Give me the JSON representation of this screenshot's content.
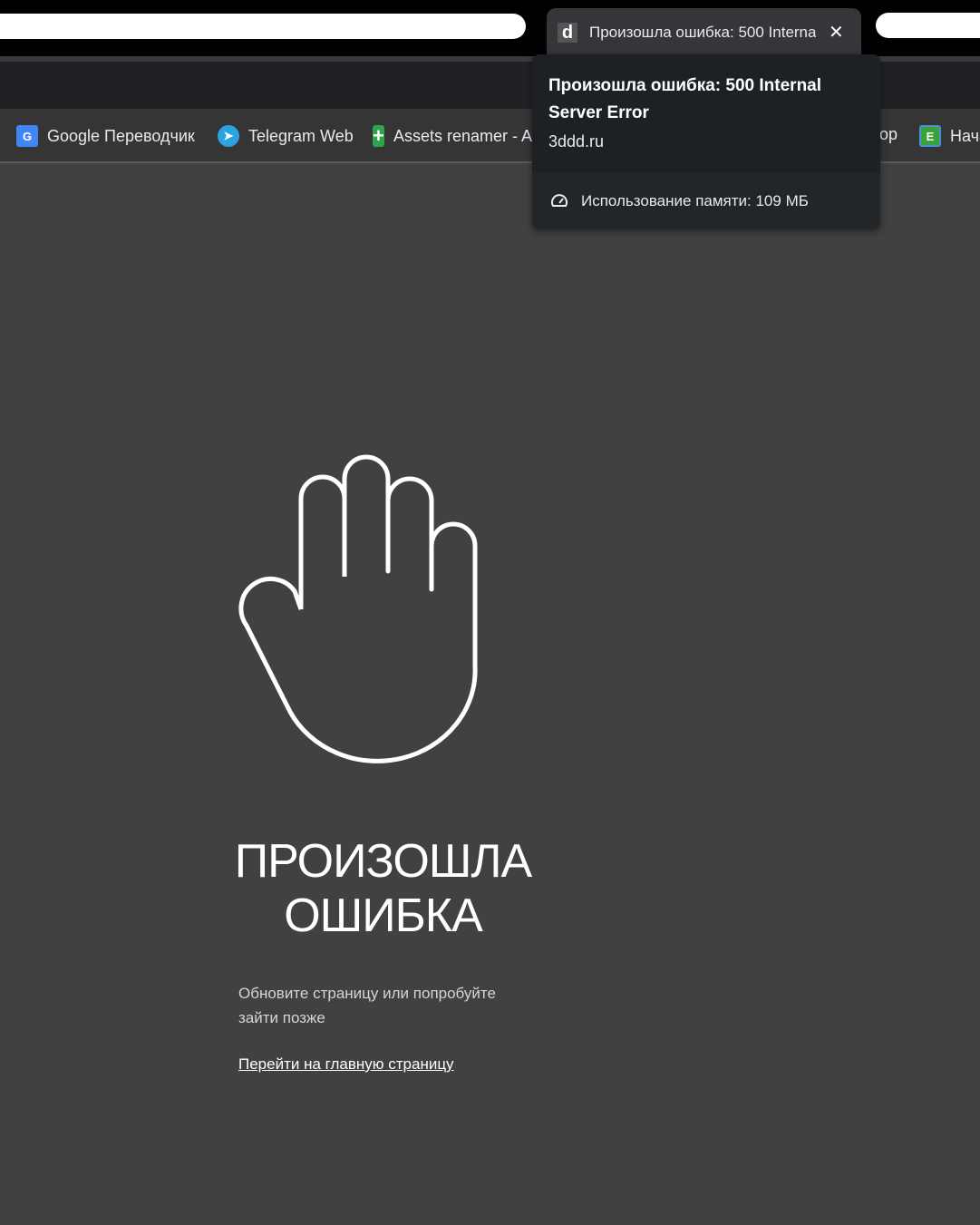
{
  "tab": {
    "title": "Произошла ошибка: 500 Internal Server Error",
    "favicon": "d",
    "close": "✕"
  },
  "bookmarks": [
    {
      "label": "Google Переводчик",
      "icon": "google-translate-icon",
      "color": "#4285f4"
    },
    {
      "label": "Telegram Web",
      "icon": "telegram-icon",
      "color": "#2aa3e0"
    },
    {
      "label": "Assets renamer - A",
      "icon": "plus-icon",
      "color": "#2ea44f"
    },
    {
      "label": "op",
      "icon": "",
      "color": ""
    },
    {
      "label": "Нача",
      "icon": "e-icon",
      "color": "#3ba23b"
    }
  ],
  "hover_card": {
    "title": "Произошла ошибка: 500 Internal Server Error",
    "domain": "3ddd.ru",
    "memory": "Использование памяти: 109 МБ"
  },
  "page": {
    "heading": "ПРОИЗОШЛА ОШИБКА",
    "message": "Обновите страницу или попробуйте зайти позже",
    "home_link": "Перейти на главную страницу"
  }
}
